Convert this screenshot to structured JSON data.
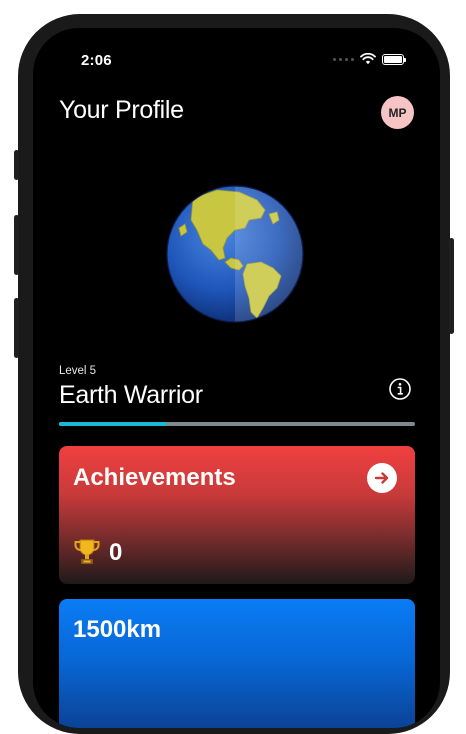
{
  "status_bar": {
    "time": "2:06"
  },
  "header": {
    "title": "Your Profile",
    "avatar_initials": "MP"
  },
  "level": {
    "label": "Level 5",
    "rank": "Earth Warrior",
    "progress": 0.3
  },
  "achievements_card": {
    "title": "Achievements",
    "count": "0"
  },
  "distance_card": {
    "value": "1500km"
  },
  "colors": {
    "progress_fill": "#17b9d6",
    "progress_track": "#7d8a90",
    "achievements_gradient_top": "#f0403f",
    "distance_gradient_top": "#0a7cf5",
    "avatar_bg": "#f6c4c4"
  },
  "icons": [
    "wifi-icon",
    "battery-icon",
    "globe-icon",
    "info-icon",
    "arrow-right-icon",
    "trophy-icon"
  ]
}
